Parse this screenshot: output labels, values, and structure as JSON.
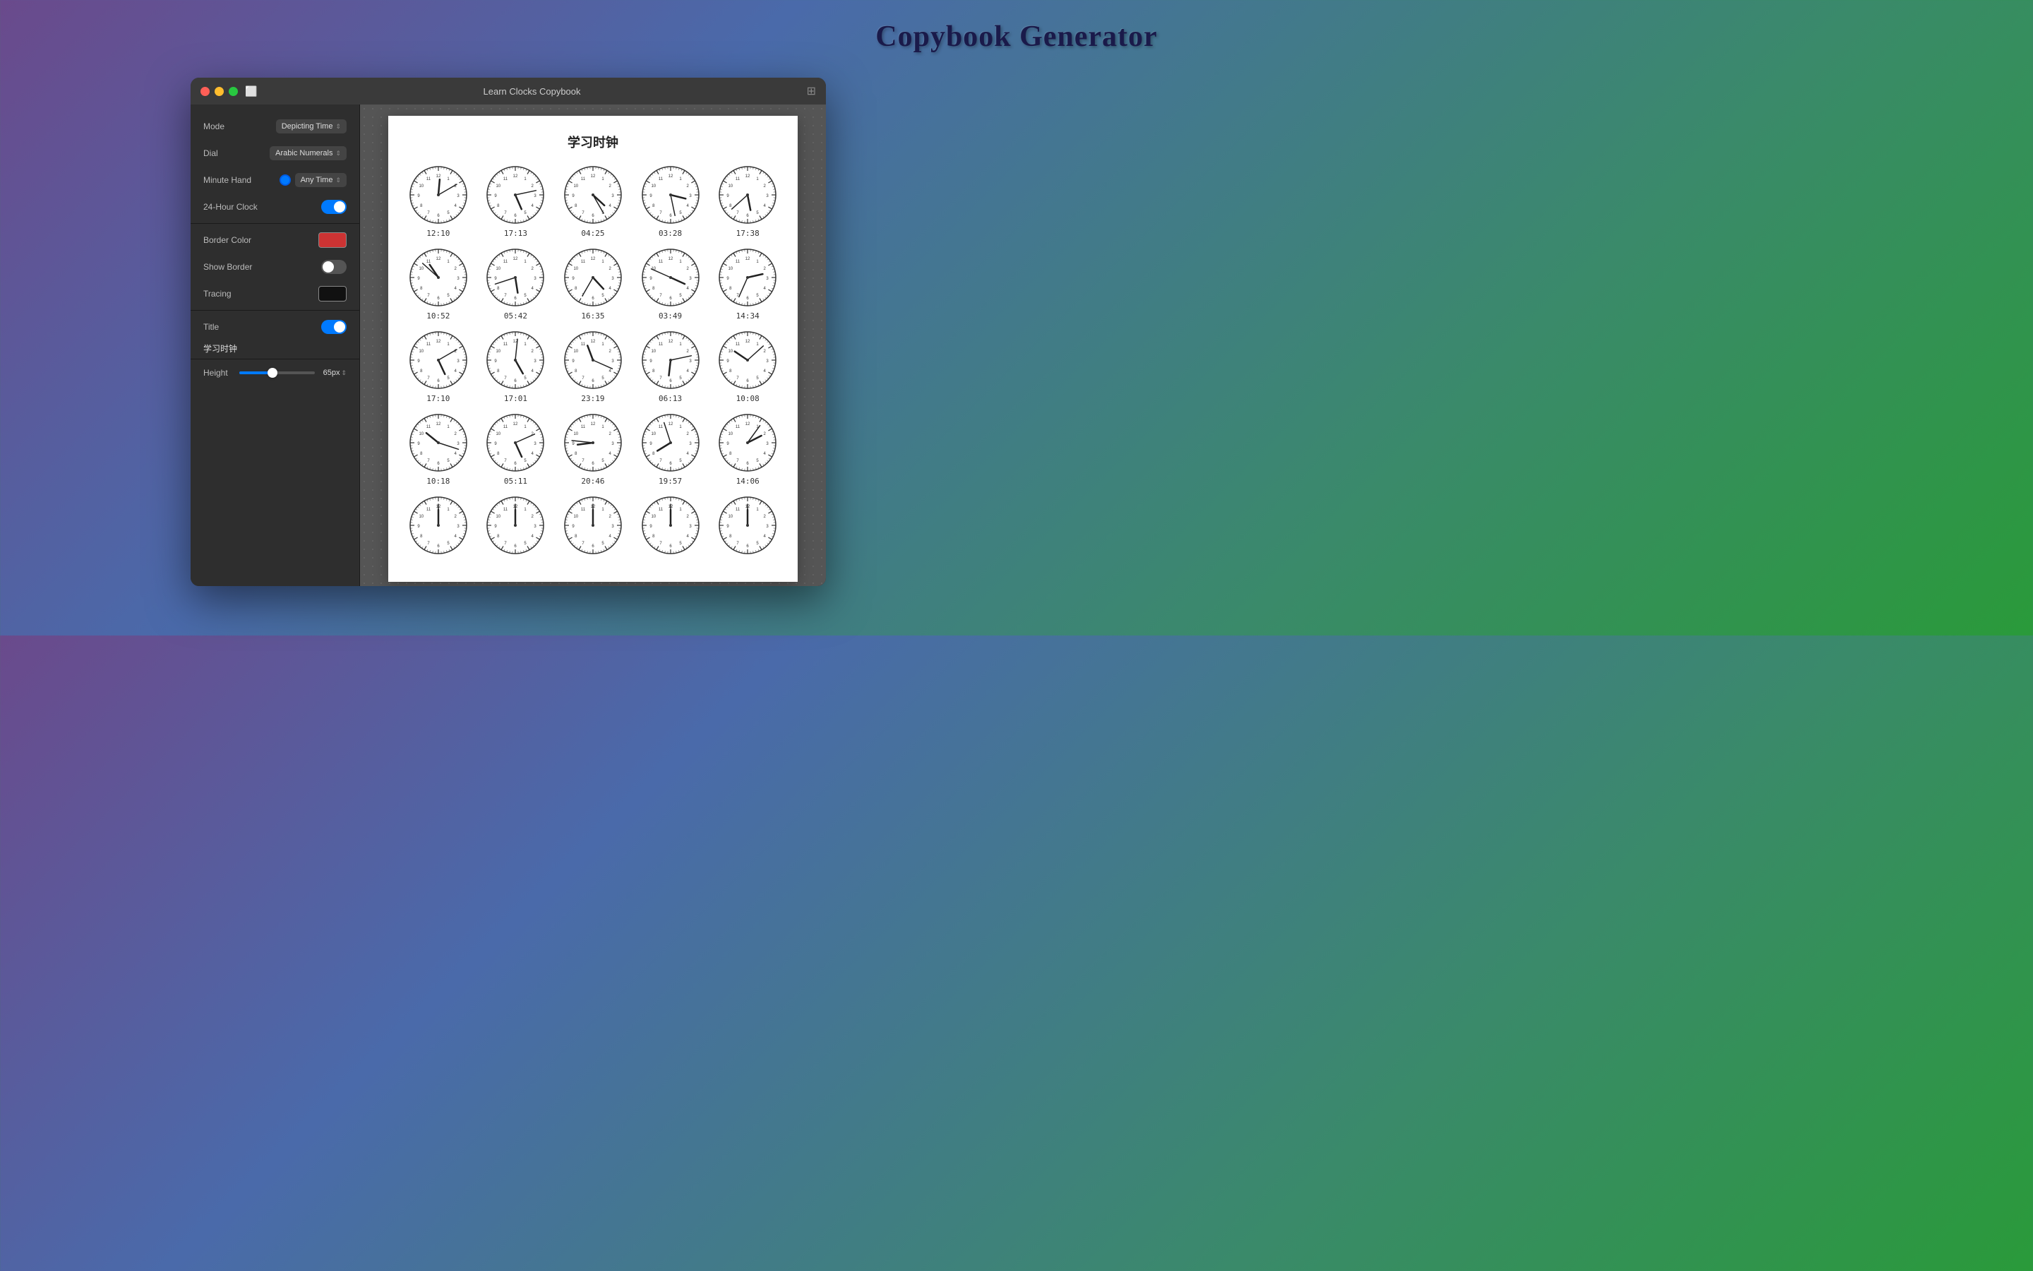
{
  "app": {
    "title": "Copybook Generator",
    "window_title": "Learn Clocks Copybook"
  },
  "sidebar": {
    "mode_label": "Mode",
    "mode_value": "Depicting Time",
    "dial_label": "Dial",
    "dial_value": "Arabic Numerals",
    "minute_hand_label": "Minute Hand",
    "minute_hand_value": "Any Time",
    "hour_clock_label": "24-Hour Clock",
    "hour_clock_on": true,
    "border_color_label": "Border Color",
    "show_border_label": "Show Border",
    "show_border_on": false,
    "tracing_label": "Tracing",
    "title_label": "Title",
    "title_on": true,
    "title_text": "学习时钟",
    "height_label": "Height",
    "height_value": "65px",
    "height_percent": 40
  },
  "paper": {
    "title": "学习时钟",
    "clocks": [
      {
        "time": "12:10"
      },
      {
        "time": "17:13"
      },
      {
        "time": "04:25"
      },
      {
        "time": "03:28"
      },
      {
        "time": "17:38"
      },
      {
        "time": "10:52"
      },
      {
        "time": "05:42"
      },
      {
        "time": "16:35"
      },
      {
        "time": "03:49"
      },
      {
        "time": "14:34"
      },
      {
        "time": "17:10"
      },
      {
        "time": "17:01"
      },
      {
        "time": "23:19"
      },
      {
        "time": "06:13"
      },
      {
        "time": "10:08"
      },
      {
        "time": "10:18"
      },
      {
        "time": "05:11"
      },
      {
        "time": "20:46"
      },
      {
        "time": "19:57"
      },
      {
        "time": "14:06"
      },
      {
        "time": ""
      },
      {
        "time": ""
      },
      {
        "time": ""
      },
      {
        "time": ""
      },
      {
        "time": ""
      }
    ]
  }
}
